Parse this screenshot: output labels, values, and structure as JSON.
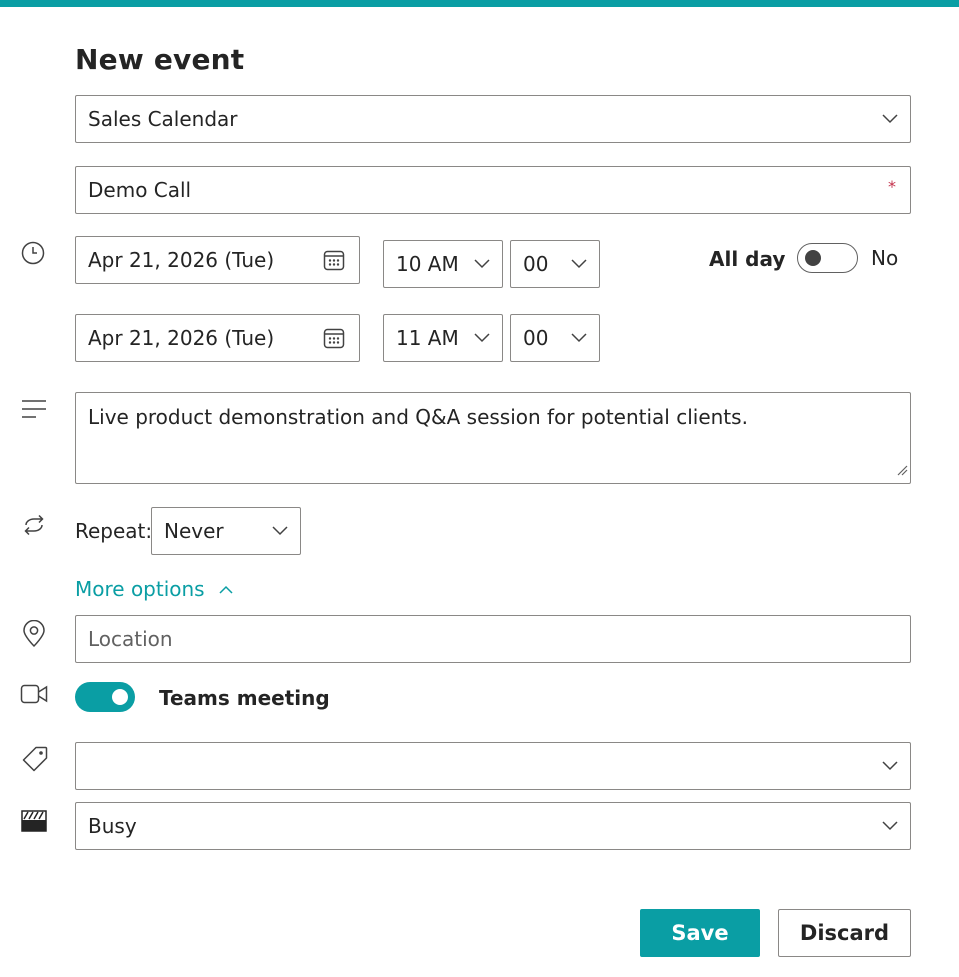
{
  "form": {
    "title": "New event",
    "calendar": {
      "value": "Sales Calendar"
    },
    "event_title": {
      "value": "Demo Call",
      "required_mark": "*"
    },
    "start": {
      "date": "Apr 21, 2026 (Tue)",
      "hour": "10 AM",
      "minute": "00"
    },
    "end": {
      "date": "Apr 21, 2026 (Tue)",
      "hour": "11 AM",
      "minute": "00"
    },
    "all_day": {
      "label": "All day",
      "state_label": "No",
      "on": false
    },
    "description": {
      "value": "Live product demonstration and Q&A session for potential clients."
    },
    "repeat": {
      "label": "Repeat:",
      "value": "Never"
    },
    "more_options": {
      "label": "More options"
    },
    "location": {
      "placeholder": "Location"
    },
    "teams_meeting": {
      "label": "Teams meeting",
      "on": true
    },
    "category": {
      "value": ""
    },
    "show_as": {
      "value": "Busy"
    }
  },
  "actions": {
    "save_label": "Save",
    "discard_label": "Discard"
  },
  "colors": {
    "accent": "#0a9ea4",
    "border": "#8a8886",
    "required": "#c4314b"
  },
  "icons": {
    "time": "clock-icon",
    "description": "text-lines-icon",
    "repeat": "repeat-icon",
    "location": "location-pin-icon",
    "teams": "video-camera-icon",
    "category": "tag-icon",
    "show_as": "busy-status-icon",
    "date_picker": "calendar-icon",
    "dropdown": "chevron-down-icon",
    "more_options": "chevron-up-icon"
  }
}
